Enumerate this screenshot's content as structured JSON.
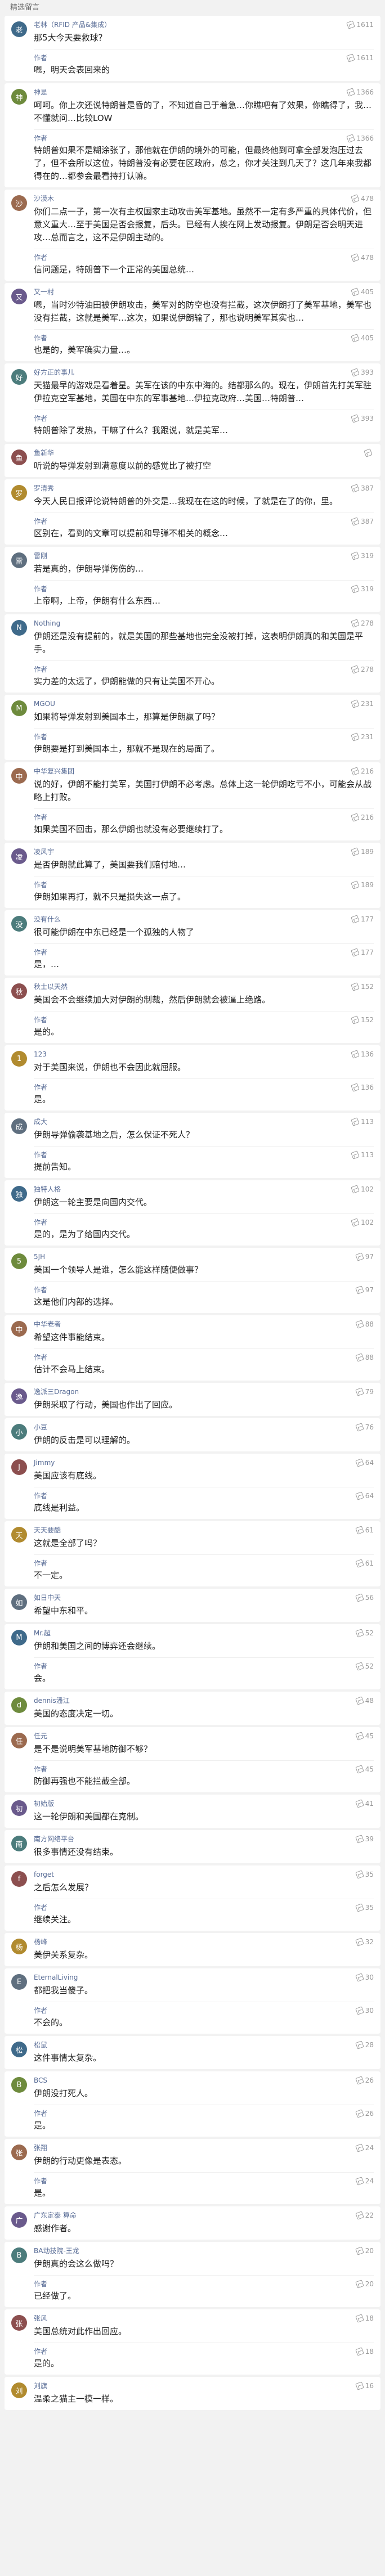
{
  "title": "精选留言",
  "comments": [
    {
      "name": "老林（RFID 产品&集成）",
      "likes": "1611",
      "text": "那5大今天要救球？",
      "reply_label": "作者",
      "reply_likes": "1611",
      "reply_text": "嗯，明天会表回来的"
    },
    {
      "name": "神是",
      "likes": "1366",
      "text": "呵呵。你上次还说特朗普是昏的了，不知道自己于着急…你瞧吧有了效果，你瞧得了，我…不懂就问…比较LOW",
      "reply_label": "作者",
      "reply_likes": "1366",
      "reply_text": "特朗普如果不是糊涂张了，那他就在伊朗的境外的可能，但最终他到可拿全部发泡压过去了，但不会所以这位，特朗普没有必要在区政府，总之，你才关注到几天了？这几年来我都得在的…都参会最看持打认嘛。"
    },
    {
      "name": "沙漠木",
      "likes": "478",
      "text": "你们二点一子，第一次有主权国家主动攻击美军基地。虽然不一定有多严重的具体代价，但意义重大…至于美国是否会报复，后头。已经有人挨在网上发动报复。伊朗是否会明天进攻…总而言之，这不是伊朗主动的。",
      "reply_label": "作者",
      "reply_likes": "478",
      "reply_text": "信问题是，特朗普下一个正常的美国总统…"
    },
    {
      "name": "又一村",
      "likes": "405",
      "text": "嗯，当时沙特油田被伊朗攻击，美军对的防空也没有拦截，这次伊朗打了美军基地，美军也没有拦截，这就是美军…这次，如果说伊朗输了，那也说明美军其实也…",
      "reply_label": "作者",
      "reply_likes": "405",
      "reply_text": "也是的，美军确实力量…。"
    },
    {
      "name": "好方正的事儿",
      "likes": "393",
      "text": "天猫最早的游戏是看着星。美军在该的中东中海的。结都那么的。现在，伊朗首先打美军驻伊拉克空军基地，美国在中东的军事基地…伊拉克政府…美国…特朗普…",
      "reply_label": "作者",
      "reply_likes": "393",
      "reply_text": "特朗普除了发热，干嘛了什么？我跟说，就是美军…"
    },
    {
      "name": "鱼新华",
      "likes": "",
      "text": "听说的导弹发射到满意度以前的感觉比了被打空",
      "reply_label": "",
      "reply_likes": "",
      "reply_text": ""
    },
    {
      "name": "罗清秀",
      "likes": "387",
      "text": "今天人民日报评论说特朗普的外交是…我现在在这的时候，了就是在了的你，里。",
      "reply_label": "作者",
      "reply_likes": "387",
      "reply_text": "区别在，看到的文章可以提前和导弹不相关的概念…"
    },
    {
      "name": "雷刚",
      "likes": "319",
      "text": "若是真的，伊朗导弹伤伤的…",
      "reply_label": "作者",
      "reply_likes": "319",
      "reply_text": "上帝啊，上帝，伊朗有什么东西…"
    },
    {
      "name": "Nothing",
      "likes": "278",
      "text": "伊朗还是没有提前的，就是美国的那些基地也完全没被打掉，这表明伊朗真的和美国是平手。",
      "reply_label": "作者",
      "reply_likes": "278",
      "reply_text": "实力差的太远了，伊朗能做的只有让美国不开心。"
    },
    {
      "name": "MGOU",
      "likes": "231",
      "text": "如果将导弹发射到美国本土，那算是伊朗赢了吗？",
      "reply_label": "作者",
      "reply_likes": "231",
      "reply_text": "伊朗要是打到美国本土，那就不是现在的局面了。"
    },
    {
      "name": "中华复兴集团",
      "likes": "216",
      "text": "说的好，伊朗不能打美军，美国打伊朗不必考虑。总体上这一轮伊朗吃亏不小，可能会从战略上打败。",
      "reply_label": "作者",
      "reply_likes": "216",
      "reply_text": "如果美国不回击，那么伊朗也就没有必要继续打了。"
    },
    {
      "name": "凌风宇",
      "likes": "189",
      "text": "是否伊朗就此算了，美国要我们赔付地…",
      "reply_label": "作者",
      "reply_likes": "189",
      "reply_text": "伊朗如果再打，就不只是损失这一点了。"
    },
    {
      "name": "没有什么",
      "likes": "177",
      "text": "很可能伊朗在中东已经是一个孤独的人物了",
      "reply_label": "作者",
      "reply_likes": "177",
      "reply_text": "是，…"
    },
    {
      "name": "秋士以天然",
      "likes": "152",
      "text": "美国会不会继续加大对伊朗的制裁，然后伊朗就会被逼上绝路。",
      "reply_label": "作者",
      "reply_likes": "152",
      "reply_text": "是的。"
    },
    {
      "name": "123",
      "likes": "136",
      "text": "对于美国来说，伊朗也不会因此就屈服。",
      "reply_label": "作者",
      "reply_likes": "136",
      "reply_text": "是。"
    },
    {
      "name": "成大",
      "likes": "113",
      "text": "伊朗导弹偷袭基地之后，怎么保证不死人？",
      "reply_label": "作者",
      "reply_likes": "113",
      "reply_text": "提前告知。"
    },
    {
      "name": "独特人格",
      "likes": "102",
      "text": "伊朗这一轮主要是向国内交代。",
      "reply_label": "作者",
      "reply_likes": "102",
      "reply_text": "是的，是为了给国内交代。"
    },
    {
      "name": "5JH",
      "likes": "97",
      "text": "美国一个领导人是谁，怎么能这样随便做事？",
      "reply_label": "作者",
      "reply_likes": "97",
      "reply_text": "这是他们内部的选择。"
    },
    {
      "name": "中华老者",
      "likes": "88",
      "text": "希望这件事能结束。",
      "reply_label": "作者",
      "reply_likes": "88",
      "reply_text": "估计不会马上结束。"
    },
    {
      "name": "逸派三Dragon",
      "likes": "79",
      "text": "伊朗采取了行动，美国也作出了回应。",
      "reply_label": "",
      "reply_likes": "",
      "reply_text": ""
    },
    {
      "name": "小豆",
      "likes": "76",
      "text": "伊朗的反击是可以理解的。",
      "reply_label": "",
      "reply_likes": "",
      "reply_text": ""
    },
    {
      "name": "Jimmy",
      "likes": "64",
      "text": "美国应该有底线。",
      "reply_label": "作者",
      "reply_likes": "64",
      "reply_text": "底线是利益。"
    },
    {
      "name": "天天要酷",
      "likes": "61",
      "text": "这就是全部了吗？",
      "reply_label": "作者",
      "reply_likes": "61",
      "reply_text": "不一定。"
    },
    {
      "name": "如日中天",
      "likes": "56",
      "text": "希望中东和平。",
      "reply_label": "",
      "reply_likes": "",
      "reply_text": ""
    },
    {
      "name": "Mr.超",
      "likes": "52",
      "text": "伊朗和美国之间的博弈还会继续。",
      "reply_label": "作者",
      "reply_likes": "52",
      "reply_text": "会。"
    },
    {
      "name": "dennis潘江",
      "likes": "48",
      "text": "美国的态度决定一切。",
      "reply_label": "",
      "reply_likes": "",
      "reply_text": ""
    },
    {
      "name": "任元",
      "likes": "45",
      "text": "是不是说明美军基地防御不够？",
      "reply_label": "作者",
      "reply_likes": "45",
      "reply_text": "防御再强也不能拦截全部。"
    },
    {
      "name": "初始版",
      "likes": "41",
      "text": "这一轮伊朗和美国都在克制。",
      "reply_label": "",
      "reply_likes": "",
      "reply_text": ""
    },
    {
      "name": "南方网络平台",
      "likes": "39",
      "text": "很多事情还没有结束。",
      "reply_label": "",
      "reply_likes": "",
      "reply_text": ""
    },
    {
      "name": "forget",
      "likes": "35",
      "text": "之后怎么发展？",
      "reply_label": "作者",
      "reply_likes": "35",
      "reply_text": "继续关注。"
    },
    {
      "name": "杨峰",
      "likes": "32",
      "text": "美伊关系复杂。",
      "reply_label": "",
      "reply_likes": "",
      "reply_text": ""
    },
    {
      "name": "EternalLiving",
      "likes": "30",
      "text": "都把我当傻子。",
      "reply_label": "作者",
      "reply_likes": "30",
      "reply_text": "不会的。"
    },
    {
      "name": "松鼠",
      "likes": "28",
      "text": "这件事情太复杂。",
      "reply_label": "",
      "reply_likes": "",
      "reply_text": ""
    },
    {
      "name": "BCS",
      "likes": "26",
      "text": "伊朗没打死人。",
      "reply_label": "作者",
      "reply_likes": "26",
      "reply_text": "是。"
    },
    {
      "name": "张翔",
      "likes": "24",
      "text": "伊朗的行动更像是表态。",
      "reply_label": "作者",
      "reply_likes": "24",
      "reply_text": "是。"
    },
    {
      "name": "广东定泰 算命",
      "likes": "22",
      "text": "感谢作者。",
      "reply_label": "",
      "reply_likes": "",
      "reply_text": ""
    },
    {
      "name": "BA动技院-王龙",
      "likes": "20",
      "text": "伊朗真的会这么做吗？",
      "reply_label": "作者",
      "reply_likes": "20",
      "reply_text": "已经做了。"
    },
    {
      "name": "张风",
      "likes": "18",
      "text": "美国总统对此作出回应。",
      "reply_label": "作者",
      "reply_likes": "18",
      "reply_text": "是的。"
    },
    {
      "name": "刘旗",
      "likes": "16",
      "text": "温柔之猫主一模一样。",
      "reply_label": "",
      "reply_likes": "",
      "reply_text": ""
    }
  ]
}
